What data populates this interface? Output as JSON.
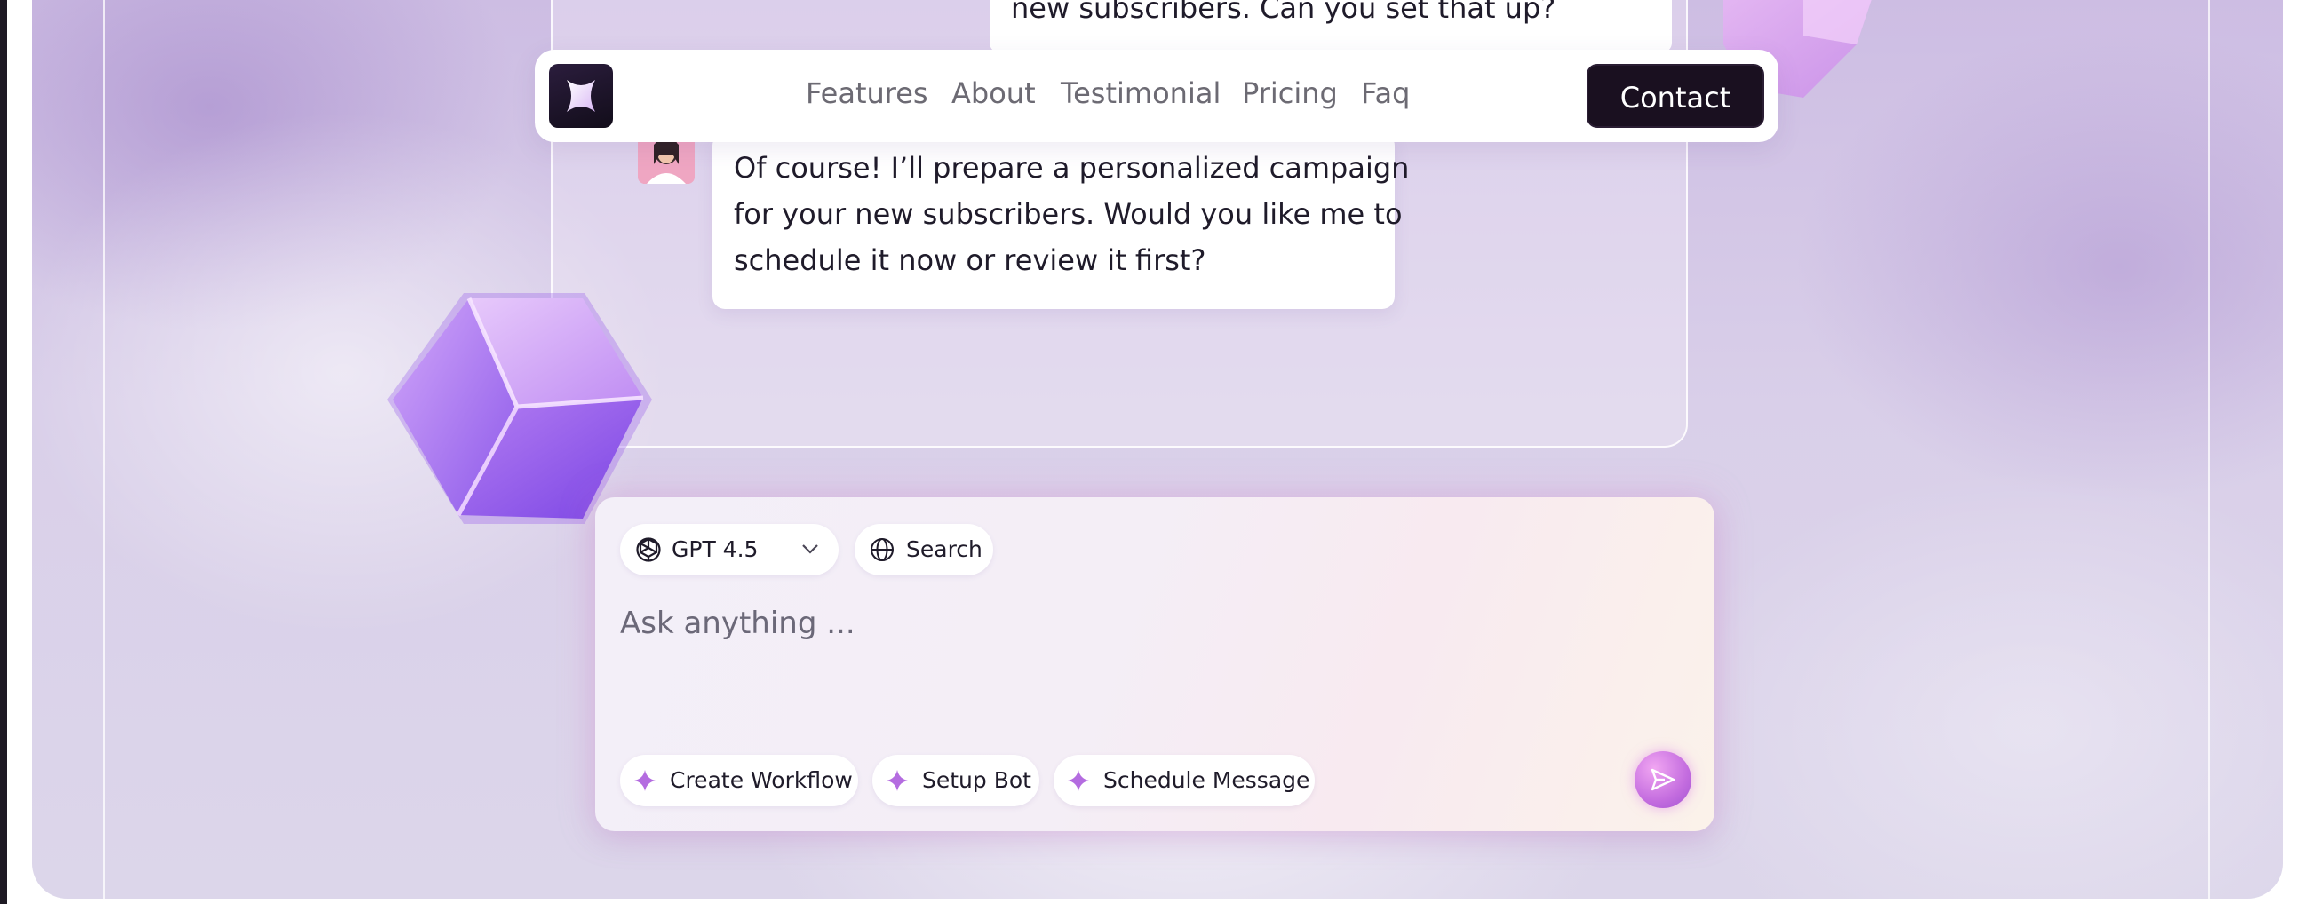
{
  "nav": {
    "logo_alt": "X logo",
    "links": [
      "Features",
      "About",
      "Testimonial",
      "Pricing",
      "Faq"
    ],
    "contact_label": "Contact"
  },
  "chat": {
    "user_message_partial": "new subscribers. Can you set that up?",
    "assistant_lines": [
      "Of course! I’ll prepare a personalized campaign",
      "for your new subscribers. Would you like me to",
      "schedule it now or review it first?"
    ]
  },
  "composer": {
    "model_label": "GPT 4.5",
    "search_label": "Search",
    "placeholder": "Ask anything ...",
    "quick_actions": [
      "Create Workflow",
      "Setup Bot",
      "Schedule Message"
    ]
  },
  "colors": {
    "accent": "#b46ce0",
    "dark": "#1a1020",
    "nav_text": "#6c6a73"
  },
  "icons": {
    "logo": "x-logo-icon",
    "model": "openai-icon",
    "dropdown": "chevron-down-icon",
    "search": "globe-icon",
    "sparkle": "sparkle-icon",
    "send": "send-icon"
  }
}
